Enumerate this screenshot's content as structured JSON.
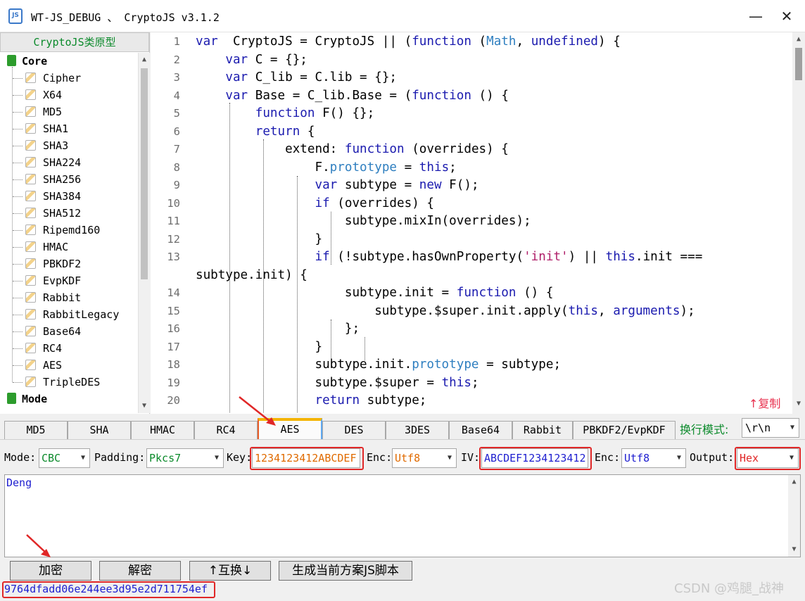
{
  "window": {
    "icon_text": "JS",
    "title": "WT-JS_DEBUG 、 CryptoJS v3.1.2",
    "minimize_glyph": "—",
    "close_glyph": "✕"
  },
  "tree": {
    "header": "CryptoJS类原型",
    "categories": [
      {
        "label": "Core",
        "items": [
          "Cipher",
          "X64",
          "MD5",
          "SHA1",
          "SHA3",
          "SHA224",
          "SHA256",
          "SHA384",
          "SHA512",
          "Ripemd160",
          "HMAC",
          "PBKDF2",
          "EvpKDF",
          "Rabbit",
          "RabbitLegacy",
          "Base64",
          "RC4",
          "AES",
          "TripleDES"
        ]
      },
      {
        "label": "Mode",
        "items": []
      }
    ]
  },
  "editor": {
    "copy_label": "↑复制",
    "lines": [
      {
        "n": "1",
        "segs": [
          [
            "kw",
            "var"
          ],
          [
            "",
            "  CryptoJS = CryptoJS || ("
          ],
          [
            "kw",
            "function"
          ],
          [
            "",
            " ("
          ],
          [
            "bi",
            "Math"
          ],
          [
            "",
            ", "
          ],
          [
            "kw",
            "undefined"
          ],
          [
            "",
            ") {"
          ]
        ]
      },
      {
        "n": "2",
        "segs": [
          [
            "",
            "    "
          ],
          [
            "kw",
            "var"
          ],
          [
            "",
            " C = {};"
          ]
        ]
      },
      {
        "n": "3",
        "segs": [
          [
            "",
            "    "
          ],
          [
            "kw",
            "var"
          ],
          [
            "",
            " C_lib = C.lib = {};"
          ]
        ]
      },
      {
        "n": "4",
        "segs": [
          [
            "",
            "    "
          ],
          [
            "kw",
            "var"
          ],
          [
            "",
            " Base = C_lib.Base = ("
          ],
          [
            "kw",
            "function"
          ],
          [
            "",
            " () {"
          ]
        ]
      },
      {
        "n": "5",
        "segs": [
          [
            "",
            "        "
          ],
          [
            "kw",
            "function"
          ],
          [
            "",
            " F() {};"
          ]
        ]
      },
      {
        "n": "6",
        "segs": [
          [
            "",
            "        "
          ],
          [
            "kw",
            "return"
          ],
          [
            "",
            " {"
          ]
        ]
      },
      {
        "n": "7",
        "segs": [
          [
            "",
            "            extend: "
          ],
          [
            "kw",
            "function"
          ],
          [
            "",
            " (overrides) {"
          ]
        ]
      },
      {
        "n": "8",
        "segs": [
          [
            "",
            "                F."
          ],
          [
            "bi",
            "prototype"
          ],
          [
            "",
            " = "
          ],
          [
            "kw",
            "this"
          ],
          [
            "",
            ";"
          ]
        ]
      },
      {
        "n": "9",
        "segs": [
          [
            "",
            "                "
          ],
          [
            "kw",
            "var"
          ],
          [
            "",
            " subtype = "
          ],
          [
            "kw",
            "new"
          ],
          [
            "",
            " F();"
          ]
        ]
      },
      {
        "n": "10",
        "segs": [
          [
            "",
            "                "
          ],
          [
            "kw",
            "if"
          ],
          [
            "",
            " (overrides) {"
          ]
        ]
      },
      {
        "n": "11",
        "segs": [
          [
            "",
            "                    subtype.mixIn(overrides);"
          ]
        ]
      },
      {
        "n": "12",
        "segs": [
          [
            "",
            "                }"
          ]
        ]
      },
      {
        "n": "13",
        "segs": [
          [
            "",
            "                "
          ],
          [
            "kw",
            "if"
          ],
          [
            "",
            " (!subtype.hasOwnProperty("
          ],
          [
            "str",
            "'init'"
          ],
          [
            "",
            ") || "
          ],
          [
            "kw",
            "this"
          ],
          [
            "",
            ".init ==="
          ]
        ]
      },
      {
        "n": "",
        "segs": [
          [
            "",
            "subtype.init) {"
          ]
        ]
      },
      {
        "n": "14",
        "segs": [
          [
            "",
            "                    subtype.init = "
          ],
          [
            "kw",
            "function"
          ],
          [
            "",
            " () {"
          ]
        ]
      },
      {
        "n": "15",
        "segs": [
          [
            "",
            "                        subtype.$super.init.apply("
          ],
          [
            "kw",
            "this"
          ],
          [
            "",
            ", "
          ],
          [
            "kw",
            "arguments"
          ],
          [
            "",
            ");"
          ]
        ]
      },
      {
        "n": "16",
        "segs": [
          [
            "",
            "                    };"
          ]
        ]
      },
      {
        "n": "17",
        "segs": [
          [
            "",
            "                }"
          ]
        ]
      },
      {
        "n": "18",
        "segs": [
          [
            "",
            "                subtype.init."
          ],
          [
            "bi",
            "prototype"
          ],
          [
            "",
            " = subtype;"
          ]
        ]
      },
      {
        "n": "19",
        "segs": [
          [
            "",
            "                subtype.$super = "
          ],
          [
            "kw",
            "this"
          ],
          [
            "",
            ";"
          ]
        ]
      },
      {
        "n": "20",
        "segs": [
          [
            "",
            "                "
          ],
          [
            "kw",
            "return"
          ],
          [
            "",
            " subtype;"
          ]
        ]
      }
    ]
  },
  "tabs": {
    "items": [
      "MD5",
      "SHA",
      "HMAC",
      "RC4",
      "AES",
      "DES",
      "3DES",
      "Base64",
      "Rabbit",
      "PBKDF2/EvpKDF"
    ],
    "active": "AES",
    "newline_label": "换行模式:",
    "newline_value": "\\r\\n"
  },
  "settings": {
    "mode_label": "Mode:",
    "mode_value": "CBC",
    "padding_label": "Padding:",
    "padding_value": "Pkcs7",
    "key_label": "Key:",
    "key_value": "1234123412ABCDEF",
    "key_enc_label": "Enc:",
    "key_enc_value": "Utf8",
    "iv_label": "IV:",
    "iv_value": "ABCDEF1234123412",
    "iv_enc_label": "Enc:",
    "iv_enc_value": "Utf8",
    "output_label": "Output:",
    "output_value": "Hex",
    "colors": {
      "green": "#0b8a2b",
      "orange": "#e06a00",
      "blue": "#2020d0",
      "red": "#e02727"
    }
  },
  "input": {
    "text": "Deng"
  },
  "actions": {
    "encrypt": "加密",
    "decrypt": "解密",
    "swap": "↑互换↓",
    "generate": "生成当前方案JS脚本"
  },
  "output": {
    "text": "9764dfadd06e244ee3d95e2d711754ef"
  },
  "watermark": "CSDN @鸡腿_战神"
}
